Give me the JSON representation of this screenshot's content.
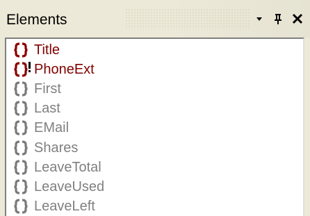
{
  "panel": {
    "title": "Elements",
    "controls": {
      "menu_icon": "dropdown-arrow-icon",
      "pin_icon": "pin-icon",
      "close_icon": "close-icon"
    }
  },
  "elements": [
    {
      "label": "Title",
      "state": "active",
      "icon": "element-icon",
      "warning": false
    },
    {
      "label": "PhoneExt",
      "state": "active",
      "icon": "element-icon",
      "warning": true
    },
    {
      "label": "First",
      "state": "inactive",
      "icon": "element-icon",
      "warning": false
    },
    {
      "label": "Last",
      "state": "inactive",
      "icon": "element-icon",
      "warning": false
    },
    {
      "label": "EMail",
      "state": "inactive",
      "icon": "element-icon",
      "warning": false
    },
    {
      "label": "Shares",
      "state": "inactive",
      "icon": "element-icon",
      "warning": false
    },
    {
      "label": "LeaveTotal",
      "state": "inactive",
      "icon": "element-icon",
      "warning": false
    },
    {
      "label": "LeaveUsed",
      "state": "inactive",
      "icon": "element-icon",
      "warning": false
    },
    {
      "label": "LeaveLeft",
      "state": "inactive",
      "icon": "element-icon",
      "warning": false
    }
  ],
  "colors": {
    "active_text": "#800000",
    "active_icon": "#8b0000",
    "inactive_text": "#808080",
    "inactive_icon": "#7a7a7a",
    "warning_mark": "#000000"
  }
}
